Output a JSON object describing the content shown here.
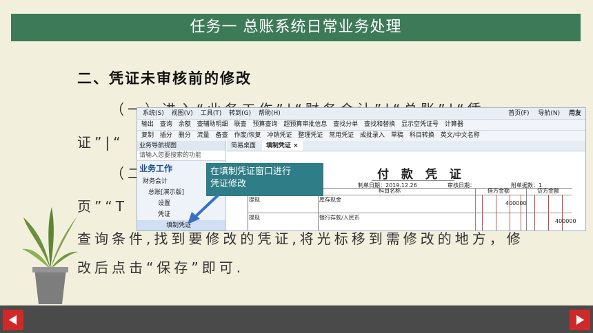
{
  "slide": {
    "title": "任务一 总账系统日常业务处理",
    "heading": "二、凭证未审核前的修改",
    "paragraph_lines": [
      "（一）进入“业务工作”|“财务会计”|“总账”|“凭",
      "证”|“",
      "（二",
      "页”“T",
      "查询条件,找到要修改的凭证,将光标移到需修改的地方，修",
      "改后点击“保存”即可."
    ]
  },
  "colors": {
    "background": "#f3efdd",
    "title_bar": "#3d7b58",
    "bottom_bar": "#4a4a4a",
    "nav_buttons": "#cf2a2a",
    "callout": "#2e7d87"
  },
  "callout": {
    "text_line1": "在填制凭证窗口进行",
    "text_line2": "凭证修改"
  },
  "software": {
    "menu": [
      "系统(S)",
      "视图(V)",
      "工具(T)",
      "转到(G)",
      "帮助(H)"
    ],
    "menu_right": [
      "首页(F)",
      "导航(N)",
      "用友"
    ],
    "toolbar1": [
      "输出",
      "查询",
      "余额",
      "查辅助明细",
      "联查",
      "预算查询",
      "超预算审批信息",
      "查找分单",
      "查找和替换",
      "显示空凭证号",
      "计算器"
    ],
    "toolbar2": [
      "复制",
      "插分",
      "删分",
      "流量",
      "备查",
      "作废/恢复",
      "冲销凭证",
      "整理凭证",
      "常用凭证",
      "成批录入",
      "草稿",
      "科目转换",
      "英文/中文名称"
    ],
    "nav_pane": {
      "header": "业务导航视图",
      "search_placeholder": "请输入您要搜索的功能",
      "title": "业务工作",
      "items": [
        "财务会计",
        "总账[演示版]",
        "设置",
        "凭证",
        "填制凭证"
      ]
    },
    "tabs": [
      "简易桌面",
      "填制凭证 ×"
    ],
    "voucher": {
      "title": "付 款 凭 证",
      "date_label": "制单日期：2019.12.26",
      "audit_label": "审核日期：",
      "attachments_label": "附单据数：1",
      "col_summary": "摘 要",
      "col_account": "科目名称",
      "col_debit": "借方金额",
      "col_credit": "贷方金额",
      "rows": [
        {
          "summary": "提现",
          "account": "库存现金",
          "debit": "400000",
          "credit": ""
        },
        {
          "summary": "提现",
          "account": "银行存款/人民币",
          "debit": "",
          "credit": "400000"
        }
      ]
    }
  }
}
